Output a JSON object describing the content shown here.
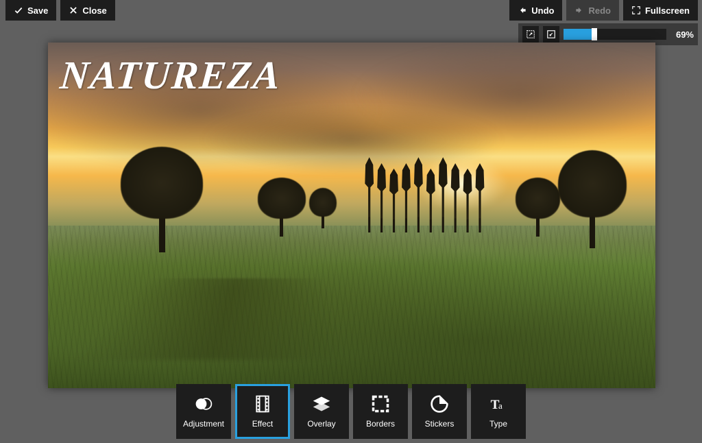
{
  "toolbar": {
    "save": "Save",
    "close": "Close",
    "undo": "Undo",
    "redo": "Redo",
    "fullscreen": "Fullscreen"
  },
  "zoom": {
    "percent_label": "69%",
    "percent_value": 69,
    "slider_fill_pct": 30
  },
  "canvas": {
    "overlay_text": "NATUREZA"
  },
  "tools": [
    {
      "id": "adjustment",
      "label": "Adjustment",
      "icon": "adjustment-icon",
      "selected": false
    },
    {
      "id": "effect",
      "label": "Effect",
      "icon": "effect-icon",
      "selected": true
    },
    {
      "id": "overlay",
      "label": "Overlay",
      "icon": "overlay-icon",
      "selected": false
    },
    {
      "id": "borders",
      "label": "Borders",
      "icon": "borders-icon",
      "selected": false
    },
    {
      "id": "stickers",
      "label": "Stickers",
      "icon": "stickers-icon",
      "selected": false
    },
    {
      "id": "type",
      "label": "Type",
      "icon": "type-icon",
      "selected": false
    }
  ]
}
